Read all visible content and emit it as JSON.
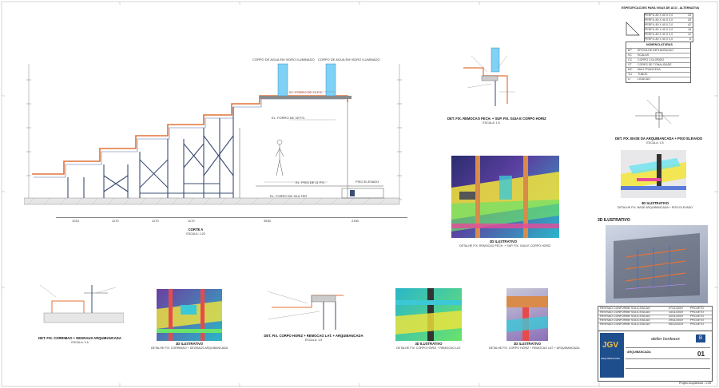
{
  "sheet": {
    "main_title": "CORTE A",
    "main_scale": "ESCALA: 1:25",
    "section_3d_title": "3D ILUSTRATIVO"
  },
  "elevation_labels": {
    "level_top": "EL. FORRO DE 15 P.S.",
    "level_mid": "EL. FORRO DE 35 P.S.",
    "level_floor": "EL. PISO DE 11 P.S.",
    "level_ground": "EL. FORRO DE 35 A TER",
    "piso_elevado": "PISO ELEVADO",
    "corpo_agua_1": "CORPO DE AGUA EM VIDRO ILUMINADO",
    "corpo_agua_2": "CORPO DE AGUA EM VIDRO ILUMINADO",
    "dims": [
      "1010",
      "1170",
      "1170",
      "1170",
      "3530",
      "2150"
    ]
  },
  "details": [
    {
      "title": "DET. FIX. REMOCAO FECH. + SUP. FIX. GUIA E CORPO HORIZ",
      "scale": "ESCALA: 1:5"
    },
    {
      "title": "DET. FIX. CORRIMAO + DEGRAUS ARQUIBANCADA",
      "scale": "ESCALA: 1:5"
    },
    {
      "title": "DET. FIX. CORPO HORIZ + REMOCAO LAT. + ARQUIBANCADA",
      "scale": "ESCALA: 1:5"
    },
    {
      "title": "DET. FIX. BASE DA ARQUIBANCADA + PISO ELEVADO",
      "scale": "ESCALA: 1:5"
    }
  ],
  "renders": [
    {
      "title": "3D ILUSTRATIVO",
      "caption": "DETALHE FIX. REMOCAO FECH. + SUP. FIX. GUIA E CORPO HORIZ"
    },
    {
      "title": "3D ILUSTRATIVO",
      "caption": "DETALHE FIX. BASE ARQUIBANCADA + PISO ELEVADO"
    },
    {
      "title": "3D ILUSTRATIVO",
      "caption": "DETALHE FIX. CORRIMAO + DEGRAUS ARQUIBANCADA"
    },
    {
      "title": "3D ILUSTRATIVO",
      "caption": "DETALHE FIX. CORPO HORIZ + REMOCAO LAT."
    },
    {
      "title": "3D ILUSTRATIVO",
      "caption": "DETALHE FIX. CORPO HORIZ + REMOCAO LAT. + ARQUIBANCADA"
    }
  ],
  "legend": {
    "title": "NOMENCLATURAS",
    "items": [
      {
        "code": "EP",
        "desc": "EPOCA DE IMPLANTACAO"
      },
      {
        "code": "SC",
        "desc": "SCALAS"
      },
      {
        "code": "CC",
        "desc": "CORPO COLORIDO"
      },
      {
        "code": "ST",
        "desc": "CORES DE TONALIDADE"
      },
      {
        "code": "MC",
        "desc": "MAO FRANCESA"
      },
      {
        "code": "TU",
        "desc": "TUBOS"
      },
      {
        "code": "LI",
        "desc": "LIGACAO"
      }
    ]
  },
  "table_top": {
    "title": "ESPECIFICACOES PARA VIGAS DE ACO - ALTERNATIVA",
    "rows": [
      [
        "PERFIL 80 X 40 X 2,0",
        "33"
      ],
      [
        "PERFIL 80 X 40 X 2,0",
        "25"
      ],
      [
        "PERFIL 80 X 40 X 2,0",
        "42"
      ],
      [
        "PERFIL 80 X 40 X 2,0",
        "18"
      ],
      [
        "PERFIL 80 X 40 X 2,0",
        "12"
      ],
      [
        "PERFIL 80 X 40 X 2,0",
        "8"
      ]
    ]
  },
  "revisions": [
    {
      "text": "REVISAO CONFORME SOLICITACAO",
      "date": "07/11/2019",
      "who": "PROJETO"
    },
    {
      "text": "REVISAO CONFORME SOLICITACAO",
      "date": "14/11/2019",
      "who": "PROJETO"
    },
    {
      "text": "REVISAO CONFORME SOLICITACAO",
      "date": "22/11/2019",
      "who": "PROJETO"
    },
    {
      "text": "REVISAO CONFORME SOLICITACAO",
      "date": "29/11/2019",
      "who": "PROJETO"
    },
    {
      "text": "REVISAO CONFORME SOLICITACAO",
      "date": "05/12/2019",
      "who": "PROJETO"
    }
  ],
  "titleblock": {
    "logo_text": "JGV",
    "logo_sub": "ARQUIBANCADA",
    "firm": "atelier bordeaux",
    "project": "ARQUIBANCADA",
    "sheet_no": "01",
    "footer": "Projeto Arquitetura - 1:25"
  }
}
